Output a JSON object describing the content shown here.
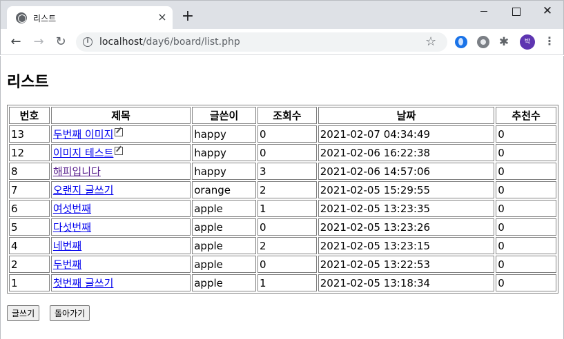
{
  "browser": {
    "tab_title": "리스트",
    "new_tab": "+",
    "close_tab": "×",
    "url_host": "localhost",
    "url_path": "/day6/board/list.php",
    "avatar_text": "박"
  },
  "page": {
    "heading": "리스트"
  },
  "table": {
    "headers": [
      "번호",
      "제목",
      "글쓴이",
      "조회수",
      "날짜",
      "추천수"
    ],
    "rows": [
      {
        "num": "13",
        "title": "두번째 이미지",
        "author": "happy",
        "views": "0",
        "date": "2021-02-07 04:34:49",
        "recommends": "0"
      },
      {
        "num": "12",
        "title": "이미지 테스트",
        "author": "happy",
        "views": "0",
        "date": "2021-02-06 16:22:38",
        "recommends": "0"
      },
      {
        "num": "8",
        "title": "해피입니다",
        "author": "happy",
        "views": "3",
        "date": "2021-02-06 14:57:06",
        "recommends": "0"
      },
      {
        "num": "7",
        "title": "오랜지 글쓰기",
        "author": "orange",
        "views": "2",
        "date": "2021-02-05 15:29:55",
        "recommends": "0"
      },
      {
        "num": "6",
        "title": "여섯번째",
        "author": "apple",
        "views": "1",
        "date": "2021-02-05 13:23:35",
        "recommends": "0"
      },
      {
        "num": "5",
        "title": "다섯번째",
        "author": "apple",
        "views": "0",
        "date": "2021-02-05 13:23:26",
        "recommends": "0"
      },
      {
        "num": "4",
        "title": "네번째",
        "author": "apple",
        "views": "2",
        "date": "2021-02-05 13:23:15",
        "recommends": "0"
      },
      {
        "num": "2",
        "title": "두번째",
        "author": "apple",
        "views": "0",
        "date": "2021-02-05 13:22:53",
        "recommends": "0"
      },
      {
        "num": "1",
        "title": "첫번째 글쓰기",
        "author": "apple",
        "views": "1",
        "date": "2021-02-05 13:18:34",
        "recommends": "0"
      }
    ]
  },
  "buttons": {
    "write": "글쓰기",
    "back": "돌아가기"
  }
}
